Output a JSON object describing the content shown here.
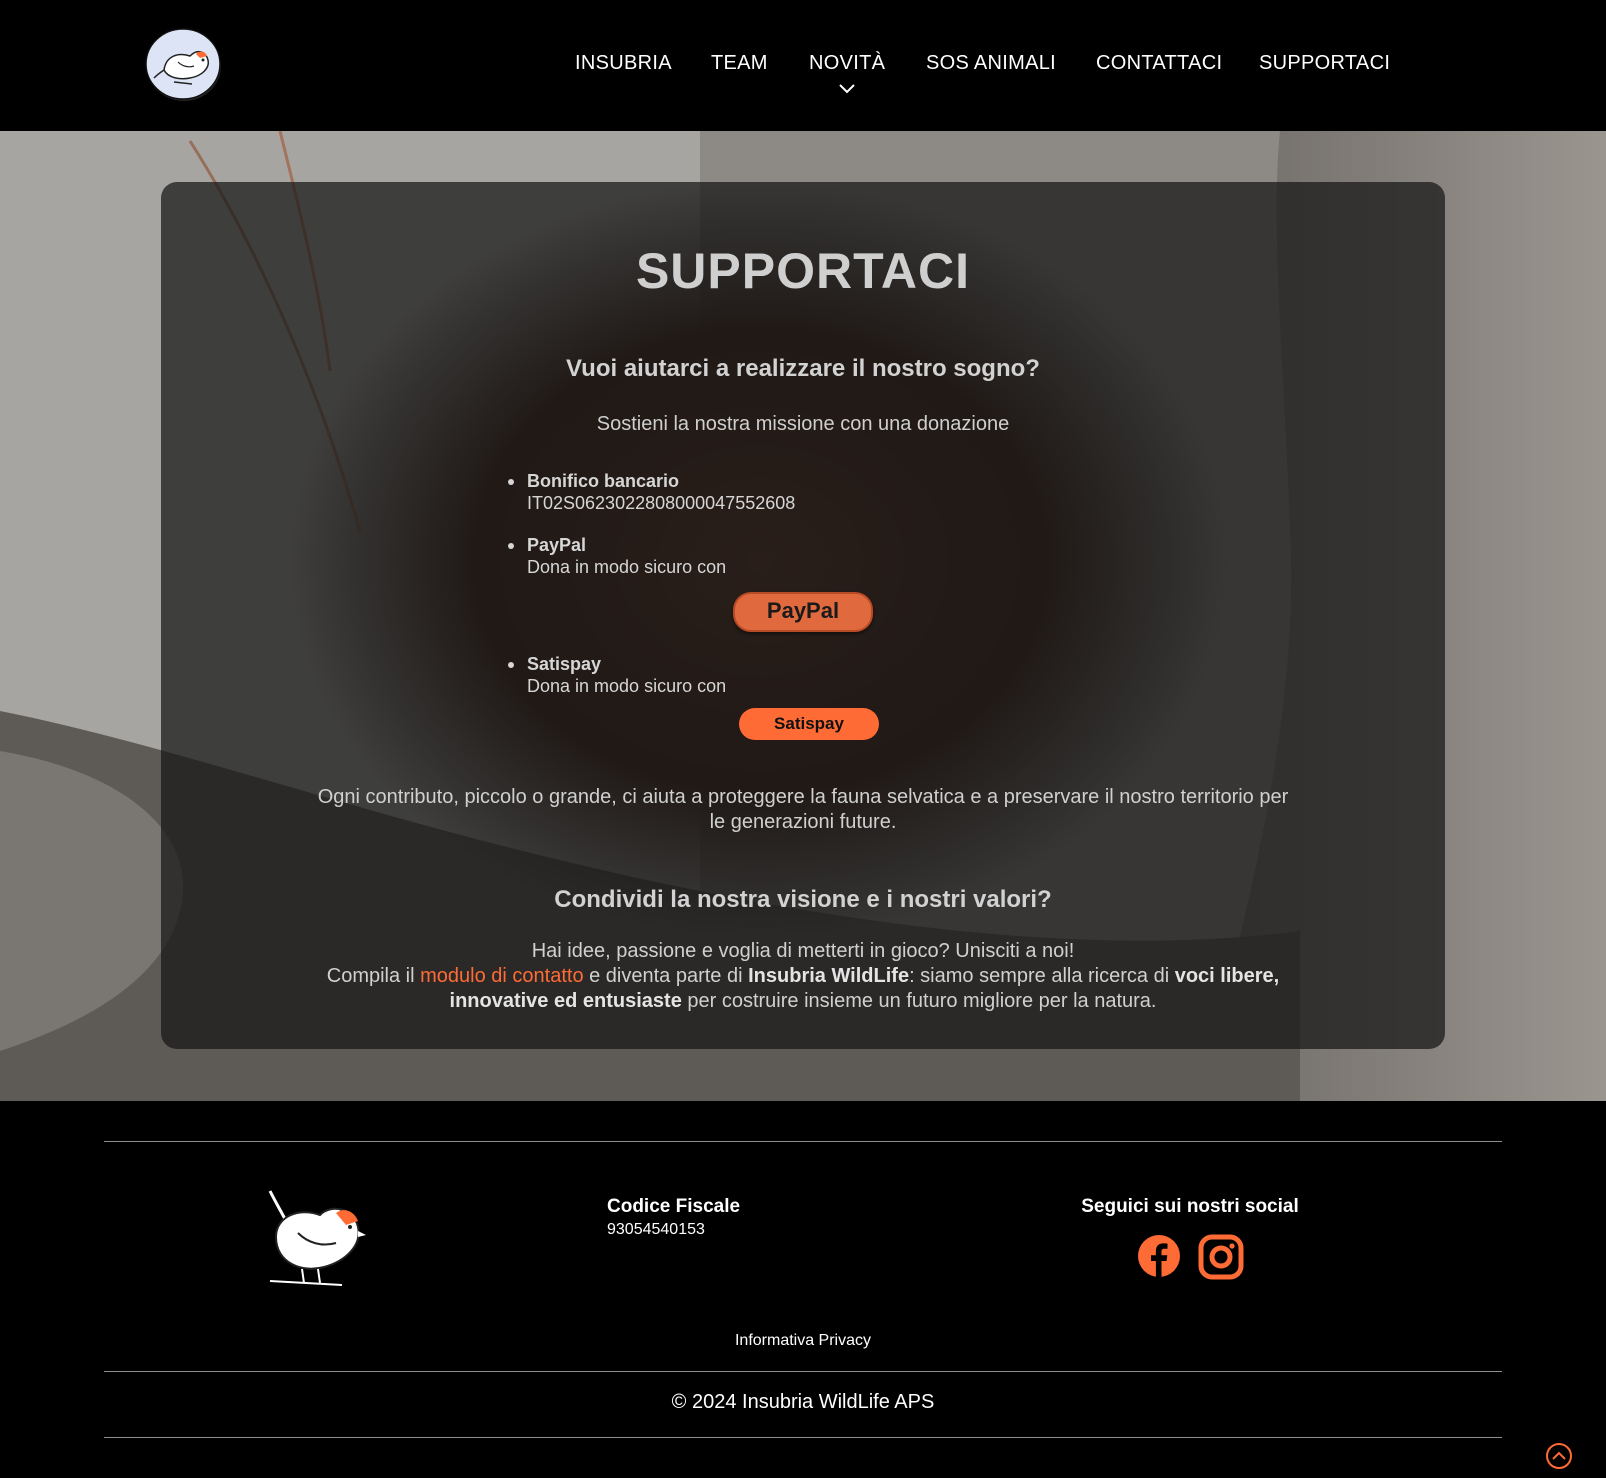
{
  "header": {
    "nav": [
      {
        "label": "INSUBRIA"
      },
      {
        "label": "TEAM"
      },
      {
        "label": "NOVITÀ"
      },
      {
        "label": "SOS ANIMALI"
      },
      {
        "label": "CONTATTACI"
      },
      {
        "label": "SUPPORTACI"
      }
    ]
  },
  "main": {
    "title": "SUPPORTACI",
    "subtitle": "Vuoi aiutarci a realizzare il nostro sogno?",
    "lead": "Sostieni la nostra missione con una donazione",
    "donations": [
      {
        "name": "Bonifico bancario",
        "value": "IT02S0623022808000047552608"
      },
      {
        "name": "PayPal",
        "value": "Dona in modo sicuro con",
        "button": "PayPal"
      },
      {
        "name": "Satispay",
        "value": "Dona in modo sicuro con",
        "button": "Satispay"
      }
    ],
    "note": "Ogni contributo, piccolo o grande, ci aiuta a proteggere la fauna selvatica e a preservare il nostro territorio per le generazioni future.",
    "subtitle2": "Condividi la nostra visione e i nostri valori?",
    "join": {
      "line1": "Hai idee, passione e voglia di metterti in gioco? Unisciti a noi!",
      "prefix": "Compila il ",
      "link": "modulo di contatto",
      "mid": " e diventa parte di ",
      "org": "Insubria WildLife",
      "mid2": ": siamo sempre alla ricerca di ",
      "bold2": "voci libere, innovative ed entusiaste",
      "suffix": " per costruire insieme un futuro migliore per la natura."
    }
  },
  "footer": {
    "fiscal_label": "Codice Fiscale",
    "fiscal_value": "93054540153",
    "social_label": "Seguici sui nostri social",
    "social_icons": [
      "facebook-icon",
      "instagram-icon"
    ],
    "privacy": "Informativa Privacy",
    "copyright": "© 2024 Insubria WildLife APS"
  },
  "colors": {
    "accent": "#ff6b35",
    "background": "#000000",
    "card": "#161616"
  }
}
